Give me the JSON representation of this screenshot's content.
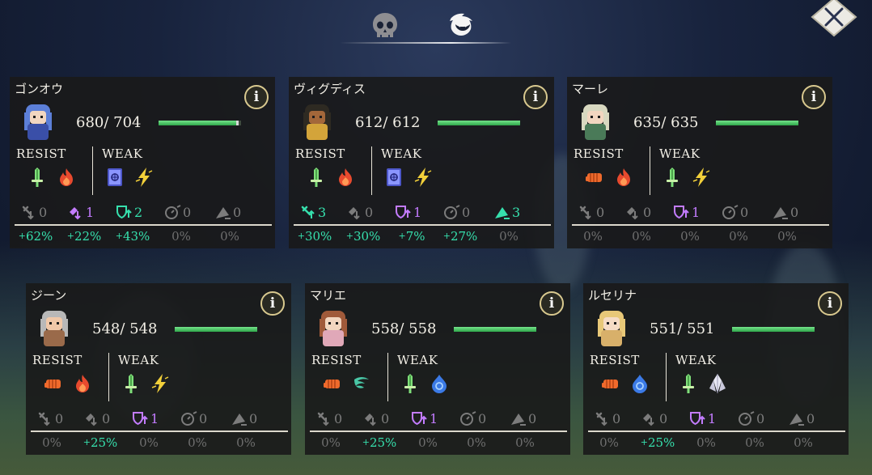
{
  "close_label": "×",
  "tabs": [
    {
      "name": "skull-icon"
    },
    {
      "name": "mask-icon",
      "active": true
    }
  ],
  "colors": {
    "hp": "#4cc764",
    "cyan_buff": "#36e0ad",
    "purple_buff": "#c37cff",
    "dim": "#7c7c7c"
  },
  "labels": {
    "resist": "RESIST",
    "weak": "WEAK"
  },
  "cards": [
    {
      "name": "ゴンオウ",
      "hp": "680/  704",
      "hp_ratio": 0.966,
      "resist": [
        "sword",
        "fire"
      ],
      "weak": [
        "tome",
        "lightning"
      ],
      "buffs": [
        {
          "icon": "atk-down",
          "value": "0",
          "tone": "dim"
        },
        {
          "icon": "matk-down",
          "value": "1",
          "tone": "purple"
        },
        {
          "icon": "def-up",
          "value": "2",
          "tone": "cyan"
        },
        {
          "icon": "speed",
          "value": "0",
          "tone": "dim"
        },
        {
          "icon": "crit",
          "value": "0",
          "tone": "dim"
        }
      ],
      "pcts": [
        {
          "plus": "+",
          "value": "62%",
          "tone": "cyan"
        },
        {
          "plus": "+",
          "value": "22%",
          "tone": "cyan"
        },
        {
          "plus": "+",
          "value": "43%",
          "tone": "cyan"
        },
        {
          "plus": "",
          "value": "0%",
          "tone": "dim"
        },
        {
          "plus": "",
          "value": "0%",
          "tone": "dim"
        }
      ]
    },
    {
      "name": "ヴィグディス",
      "hp": "612/  612",
      "hp_ratio": 1.0,
      "resist": [
        "sword",
        "fire"
      ],
      "weak": [
        "tome",
        "lightning"
      ],
      "buffs": [
        {
          "icon": "atk-up",
          "value": "3",
          "tone": "cyan"
        },
        {
          "icon": "matk-down",
          "value": "0",
          "tone": "dim"
        },
        {
          "icon": "def-up",
          "value": "1",
          "tone": "purple"
        },
        {
          "icon": "speed",
          "value": "0",
          "tone": "dim"
        },
        {
          "icon": "crit",
          "value": "3",
          "tone": "cyan"
        }
      ],
      "pcts": [
        {
          "plus": "+",
          "value": "30%",
          "tone": "cyan"
        },
        {
          "plus": "+",
          "value": "30%",
          "tone": "cyan"
        },
        {
          "plus": "+",
          "value": "7%",
          "tone": "cyan"
        },
        {
          "plus": "+",
          "value": "27%",
          "tone": "cyan"
        },
        {
          "plus": "",
          "value": "0%",
          "tone": "dim"
        }
      ]
    },
    {
      "name": "マーレ",
      "hp": "635/  635",
      "hp_ratio": 1.0,
      "resist": [
        "fist",
        "fire"
      ],
      "weak": [
        "sword",
        "lightning"
      ],
      "buffs": [
        {
          "icon": "atk-down",
          "value": "0",
          "tone": "dim"
        },
        {
          "icon": "matk-down",
          "value": "0",
          "tone": "dim"
        },
        {
          "icon": "def-up",
          "value": "1",
          "tone": "purple"
        },
        {
          "icon": "speed",
          "value": "0",
          "tone": "dim"
        },
        {
          "icon": "crit",
          "value": "0",
          "tone": "dim"
        }
      ],
      "pcts": [
        {
          "plus": "",
          "value": "0%",
          "tone": "dim"
        },
        {
          "plus": "",
          "value": "0%",
          "tone": "dim"
        },
        {
          "plus": "",
          "value": "0%",
          "tone": "dim"
        },
        {
          "plus": "",
          "value": "0%",
          "tone": "dim"
        },
        {
          "plus": "",
          "value": "0%",
          "tone": "dim"
        }
      ]
    },
    {
      "name": "ジーン",
      "hp": "548/  548",
      "hp_ratio": 1.0,
      "resist": [
        "fist",
        "fire"
      ],
      "weak": [
        "sword",
        "lightning"
      ],
      "buffs": [
        {
          "icon": "atk-down",
          "value": "0",
          "tone": "dim"
        },
        {
          "icon": "matk-down",
          "value": "0",
          "tone": "dim"
        },
        {
          "icon": "def-up",
          "value": "1",
          "tone": "purple"
        },
        {
          "icon": "speed",
          "value": "0",
          "tone": "dim"
        },
        {
          "icon": "crit",
          "value": "0",
          "tone": "dim"
        }
      ],
      "pcts": [
        {
          "plus": "",
          "value": "0%",
          "tone": "dim"
        },
        {
          "plus": "+",
          "value": "25%",
          "tone": "cyan"
        },
        {
          "plus": "",
          "value": "0%",
          "tone": "dim"
        },
        {
          "plus": "",
          "value": "0%",
          "tone": "dim"
        },
        {
          "plus": "",
          "value": "0%",
          "tone": "dim"
        }
      ]
    },
    {
      "name": "マリエ",
      "hp": "558/  558",
      "hp_ratio": 1.0,
      "resist": [
        "fist",
        "wind"
      ],
      "weak": [
        "sword",
        "water"
      ],
      "buffs": [
        {
          "icon": "atk-down",
          "value": "0",
          "tone": "dim"
        },
        {
          "icon": "matk-down",
          "value": "0",
          "tone": "dim"
        },
        {
          "icon": "def-up",
          "value": "1",
          "tone": "purple"
        },
        {
          "icon": "speed",
          "value": "0",
          "tone": "dim"
        },
        {
          "icon": "crit",
          "value": "0",
          "tone": "dim"
        }
      ],
      "pcts": [
        {
          "plus": "",
          "value": "0%",
          "tone": "dim"
        },
        {
          "plus": "+",
          "value": "25%",
          "tone": "cyan"
        },
        {
          "plus": "",
          "value": "0%",
          "tone": "dim"
        },
        {
          "plus": "",
          "value": "0%",
          "tone": "dim"
        },
        {
          "plus": "",
          "value": "0%",
          "tone": "dim"
        }
      ]
    },
    {
      "name": "ルセリナ",
      "hp": "551/  551",
      "hp_ratio": 1.0,
      "resist": [
        "fist",
        "water"
      ],
      "weak": [
        "sword",
        "crystal"
      ],
      "buffs": [
        {
          "icon": "atk-down",
          "value": "0",
          "tone": "dim"
        },
        {
          "icon": "matk-down",
          "value": "0",
          "tone": "dim"
        },
        {
          "icon": "def-up",
          "value": "1",
          "tone": "purple"
        },
        {
          "icon": "speed",
          "value": "0",
          "tone": "dim"
        },
        {
          "icon": "crit",
          "value": "0",
          "tone": "dim"
        }
      ],
      "pcts": [
        {
          "plus": "",
          "value": "0%",
          "tone": "dim"
        },
        {
          "plus": "+",
          "value": "25%",
          "tone": "cyan"
        },
        {
          "plus": "",
          "value": "0%",
          "tone": "dim"
        },
        {
          "plus": "",
          "value": "0%",
          "tone": "dim"
        },
        {
          "plus": "",
          "value": "0%",
          "tone": "dim"
        }
      ]
    }
  ]
}
